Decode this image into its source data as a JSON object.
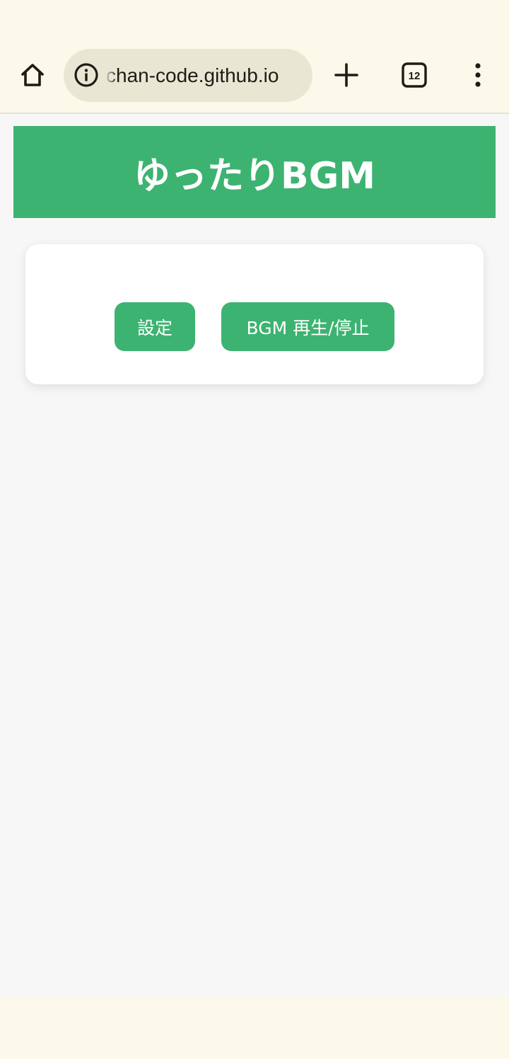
{
  "browser": {
    "url": "chan-code.github.io",
    "tab_count": "12",
    "icons": {
      "home": "home-icon",
      "info": "info-icon",
      "new_tab": "plus-icon",
      "tabs": "tabs-icon",
      "menu": "more-vert-icon"
    }
  },
  "page": {
    "title": "ゆったりBGM",
    "buttons": {
      "settings": "設定",
      "bgm_toggle": "BGM 再生/停止"
    }
  },
  "colors": {
    "accent": "#3db371",
    "browser_chrome": "#fcf9ea",
    "url_pill": "#e9e7d4",
    "page_bg": "#f7f7f7"
  }
}
